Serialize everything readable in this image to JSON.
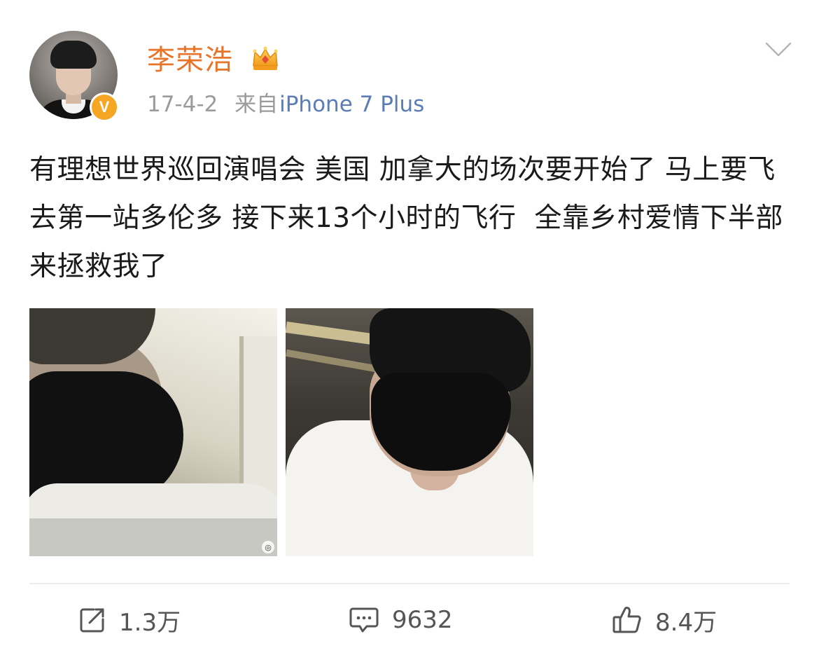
{
  "post": {
    "author": {
      "name": "李荣浩",
      "verified_badge": "V",
      "name_color": "#e8742a"
    },
    "meta": {
      "date": "17-4-2",
      "source_prefix": "来自",
      "source": "iPhone 7 Plus"
    },
    "text": "有理想世界巡回演唱会 美国 加拿大的场次要开始了 马上要飞去第一站多伦多 接下来13个小时的飞行  全靠乡村爱情下半部来拯救我了",
    "images": [
      {
        "icon": "selfie-airplane-photo"
      },
      {
        "icon": "selfie-airplane-photo"
      }
    ],
    "actions": {
      "repost": {
        "icon": "share-icon",
        "count": "1.3万"
      },
      "comment": {
        "icon": "comment-icon",
        "count": "9632"
      },
      "like": {
        "icon": "thumbs-up-icon",
        "count": "8.4万"
      }
    }
  },
  "colors": {
    "username": "#e8742a",
    "source_link": "#5b7cb4",
    "meta_gray": "#9b9b9b",
    "badge": "#f5a623"
  }
}
